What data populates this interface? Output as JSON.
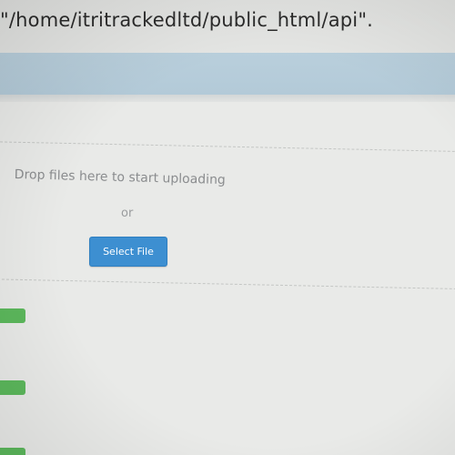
{
  "upload_target": {
    "path_text": "\"/home/itritrackedltd/public_html/api\"."
  },
  "dropzone": {
    "instruction": "Drop files here to start uploading",
    "separator": "or",
    "select_button_label": "Select File"
  },
  "colors": {
    "header_band": "#b6cdda",
    "primary_button": "#3d8fd1",
    "success_badge": "#5cb85c"
  }
}
